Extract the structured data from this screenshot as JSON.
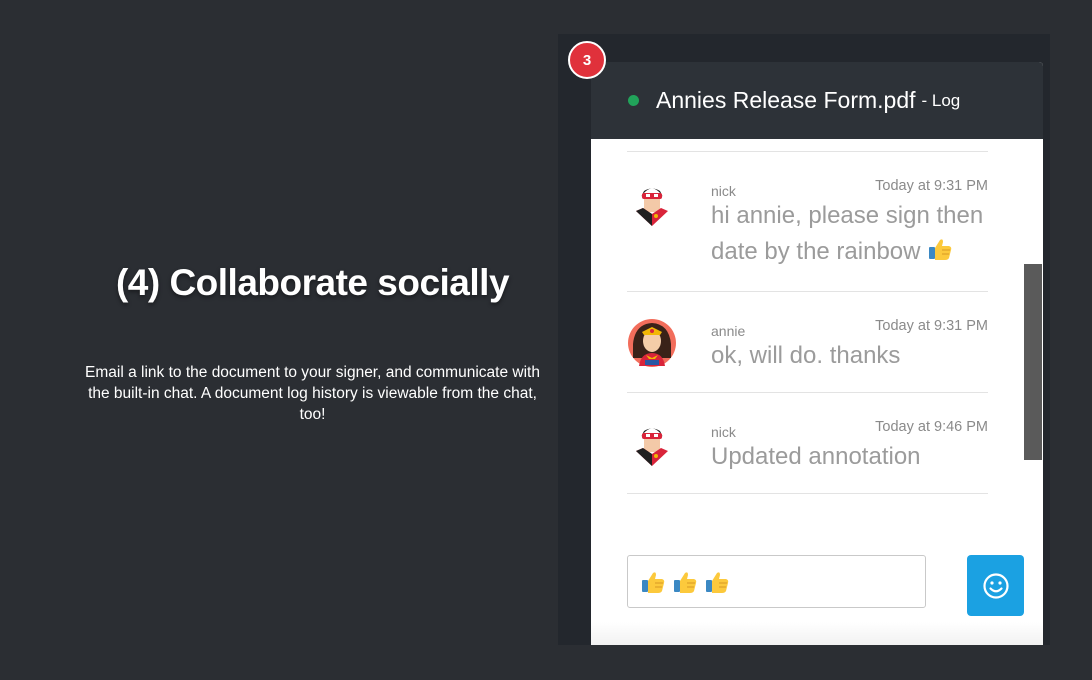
{
  "promo": {
    "headline": "(4) Collaborate socially",
    "description": "Email a link to the document to your signer, and communicate with the built-in chat. A document log history is viewable from the chat, too!"
  },
  "step_badge": "3",
  "chat": {
    "status_color": "#21a35a",
    "document_title": "Annies Release Form.pdf",
    "title_suffix": "- Log",
    "messages": [
      {
        "sender": "nick",
        "time": "Today at 9:31 PM",
        "text": "hi annie, please sign then date by the rainbow",
        "emoji": "thumbs-up-icon",
        "avatar": "superhero-avatar-icon"
      },
      {
        "sender": "annie",
        "time": "Today at 9:31 PM",
        "text": "ok, will do. thanks",
        "avatar": "heroine-avatar-icon"
      },
      {
        "sender": "nick",
        "time": "Today at 9:46 PM",
        "text": "Updated annotation",
        "avatar": "superhero-avatar-icon"
      }
    ],
    "input_value_emojis": [
      "thumbs-up-icon",
      "thumbs-up-icon",
      "thumbs-up-icon"
    ],
    "emoji_button_icon": "smiley-icon",
    "accent_color": "#1ba1e2"
  }
}
